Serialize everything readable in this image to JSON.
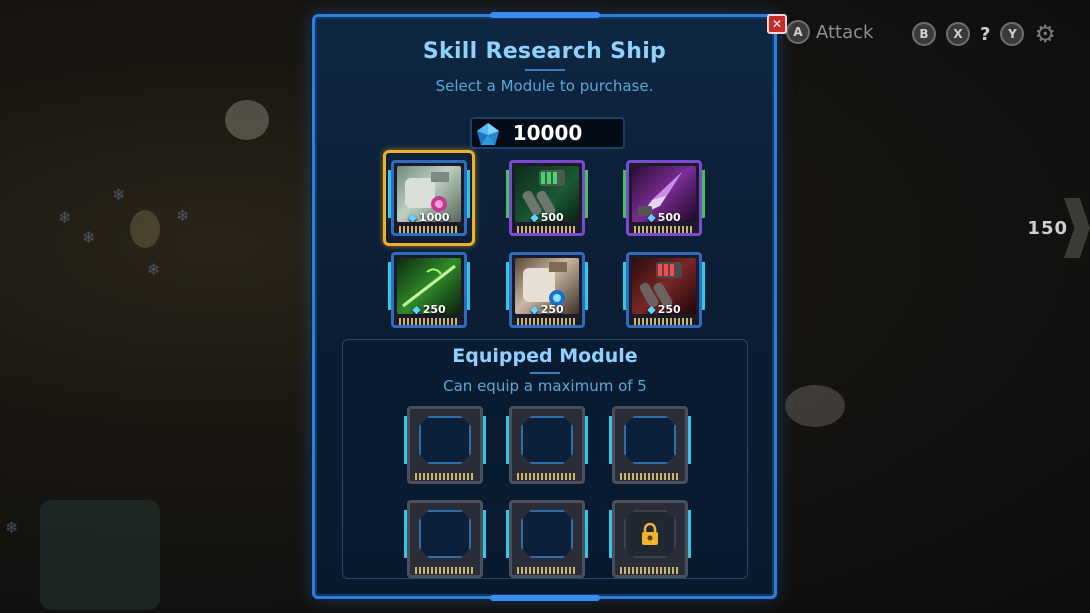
{
  "hud": {
    "attack_label": "Attack",
    "buttons": [
      "B",
      "X",
      "Y"
    ],
    "side_value": "150"
  },
  "dialog": {
    "title": "Skill Research Ship",
    "subtitle": "Select a Module to purchase.",
    "currency_icon": "crystal-gem-icon",
    "currency_amount": "10000",
    "close_icon": "close-icon",
    "modules": [
      {
        "price": "1000",
        "icon": "cannon-module-icon",
        "selected": true,
        "rarity": "blue"
      },
      {
        "price": "500",
        "icon": "twin-missile-module-icon",
        "selected": false,
        "rarity": "purple"
      },
      {
        "price": "500",
        "icon": "drill-module-icon",
        "selected": false,
        "rarity": "purple"
      },
      {
        "price": "250",
        "icon": "laser-strike-module-icon",
        "selected": false,
        "rarity": "blue"
      },
      {
        "price": "250",
        "icon": "shield-cannon-module-icon",
        "selected": false,
        "rarity": "blue"
      },
      {
        "price": "250",
        "icon": "rocket-pod-module-icon",
        "selected": false,
        "rarity": "blue"
      }
    ]
  },
  "equipped": {
    "title": "Equipped Module",
    "subtitle": "Can equip a maximum of 5",
    "slots": [
      {
        "state": "empty"
      },
      {
        "state": "empty"
      },
      {
        "state": "empty"
      },
      {
        "state": "empty"
      },
      {
        "state": "empty"
      },
      {
        "state": "locked",
        "icon": "padlock-icon"
      }
    ]
  },
  "colors": {
    "panel_border": "#2f7fd9",
    "title": "#8fd1ff",
    "subtitle": "#5aa7d8",
    "selected": "#f0b12a",
    "close": "#c82b2b"
  }
}
